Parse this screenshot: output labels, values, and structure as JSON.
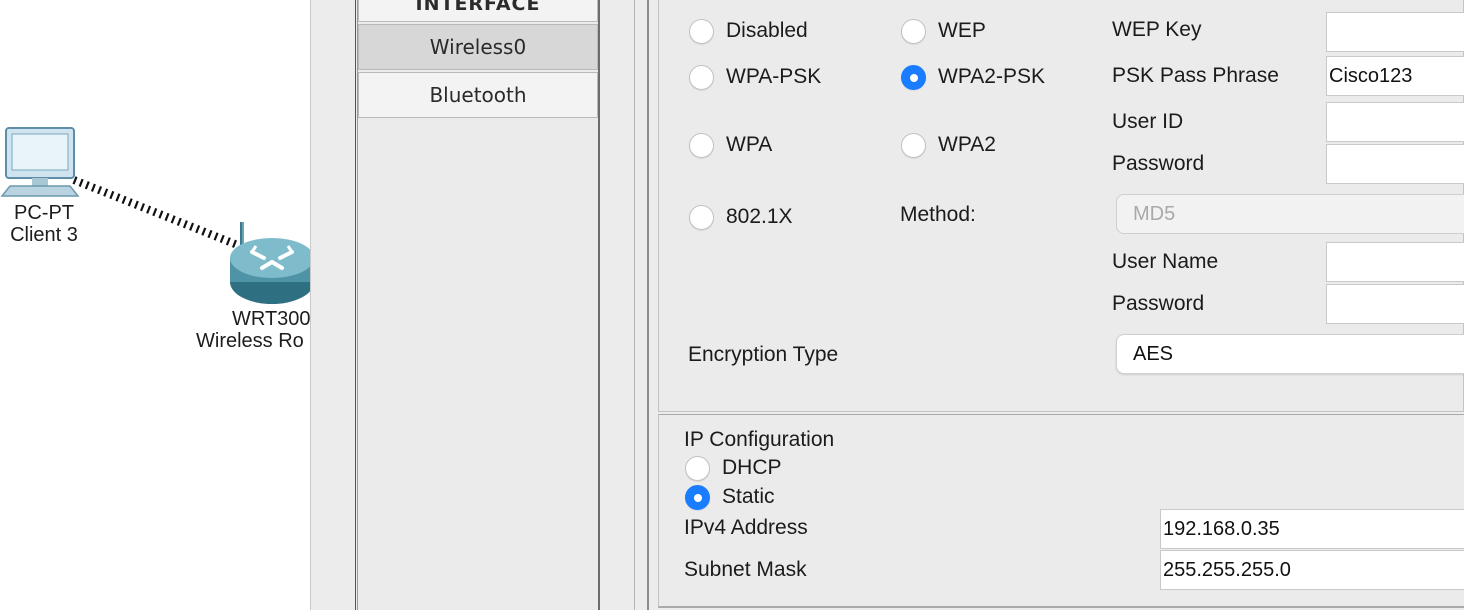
{
  "workspace": {
    "pc": {
      "line1": "PC-PT",
      "line2": "Client 3"
    },
    "router": {
      "line1": "WRT300",
      "line2": "Wireless Ro"
    }
  },
  "interfaces": {
    "header": "INTERFACE",
    "items": [
      {
        "label": "Wireless0",
        "selected": true
      },
      {
        "label": "Bluetooth",
        "selected": false
      }
    ]
  },
  "authentication": {
    "options": {
      "disabled": "Disabled",
      "wep": "WEP",
      "wpa_psk": "WPA-PSK",
      "wpa2_psk": "WPA2-PSK",
      "wpa": "WPA",
      "wpa2": "WPA2",
      "dot1x": "802.1X"
    },
    "selected": "WPA2-PSK",
    "wep_key_label": "WEP Key",
    "wep_key_value": "",
    "psk_label": "PSK Pass Phrase",
    "psk_value": "Cisco123",
    "user_id_label": "User ID",
    "user_id_value": "",
    "password_label": "Password",
    "password_value": "",
    "method_label": "Method:",
    "method_value": "MD5",
    "user_name_label": "User Name",
    "user_name_value": "",
    "password2_label": "Password",
    "password2_value": "",
    "encryption_label": "Encryption Type",
    "encryption_value": "AES"
  },
  "ip_config": {
    "title": "IP Configuration",
    "dhcp_label": "DHCP",
    "static_label": "Static",
    "selected": "Static",
    "ipv4_label": "IPv4 Address",
    "ipv4_value": "192.168.0.35",
    "mask_label": "Subnet Mask",
    "mask_value": "255.255.255.0"
  },
  "colors": {
    "accent": "#1a7cff",
    "panel": "#ececec",
    "wireless_link": "#111111"
  },
  "icons": [
    "pc-icon",
    "router-icon",
    "wireless-link"
  ]
}
